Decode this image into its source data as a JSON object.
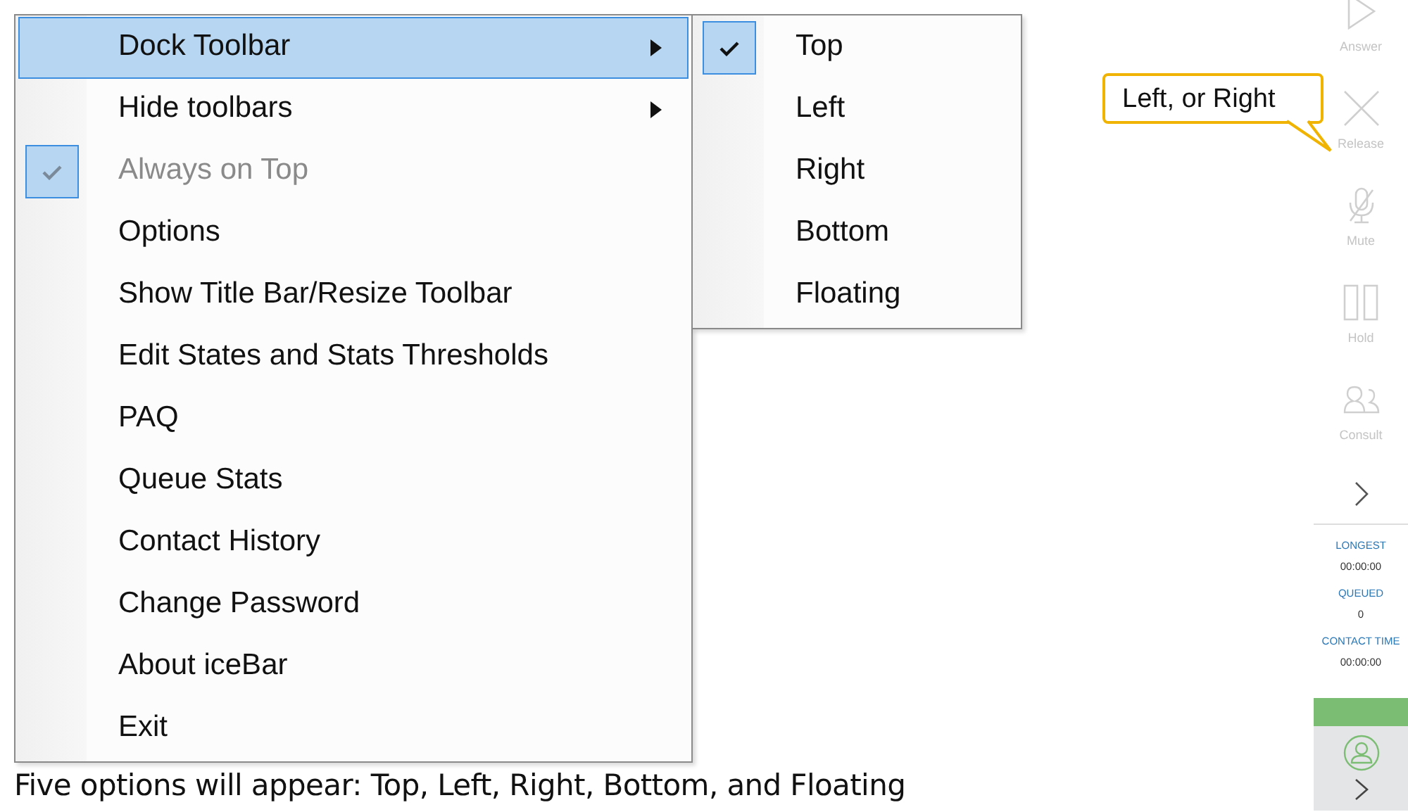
{
  "context_menu": {
    "items": [
      {
        "label": "Dock Toolbar",
        "kind": "submenu",
        "selected": true,
        "checked": false,
        "disabled": false
      },
      {
        "label": "Hide toolbars",
        "kind": "submenu",
        "selected": false,
        "checked": false,
        "disabled": false
      },
      {
        "label": "Always on Top",
        "kind": "command",
        "selected": false,
        "checked": true,
        "disabled": true
      },
      {
        "label": "Options",
        "kind": "command",
        "selected": false,
        "checked": false,
        "disabled": false
      },
      {
        "label": "Show Title Bar/Resize Toolbar",
        "kind": "command",
        "selected": false,
        "checked": false,
        "disabled": false
      },
      {
        "label": "Edit States and Stats Thresholds",
        "kind": "command",
        "selected": false,
        "checked": false,
        "disabled": false
      },
      {
        "label": "PAQ",
        "kind": "command",
        "selected": false,
        "checked": false,
        "disabled": false
      },
      {
        "label": "Queue Stats",
        "kind": "command",
        "selected": false,
        "checked": false,
        "disabled": false
      },
      {
        "label": "Contact History",
        "kind": "command",
        "selected": false,
        "checked": false,
        "disabled": false
      },
      {
        "label": "Change Password",
        "kind": "command",
        "selected": false,
        "checked": false,
        "disabled": false
      },
      {
        "label": "About iceBar",
        "kind": "command",
        "selected": false,
        "checked": false,
        "disabled": false
      },
      {
        "label": "Exit",
        "kind": "command",
        "selected": false,
        "checked": false,
        "disabled": false
      }
    ]
  },
  "submenu": {
    "items": [
      {
        "label": "Top",
        "checked": true
      },
      {
        "label": "Left",
        "checked": false
      },
      {
        "label": "Right",
        "checked": false
      },
      {
        "label": "Bottom",
        "checked": false
      },
      {
        "label": "Floating",
        "checked": false
      }
    ]
  },
  "callout": {
    "text": "Left, or Right"
  },
  "caption": "Five options will appear: Top, Left, Right, Bottom, and Floating",
  "toolbar": {
    "buttons": [
      {
        "kind": "answer",
        "label": "Answer",
        "disabled": true
      },
      {
        "kind": "release",
        "label": "Release",
        "disabled": true
      },
      {
        "kind": "mute",
        "label": "Mute",
        "disabled": true
      },
      {
        "kind": "hold",
        "label": "Hold",
        "disabled": true
      },
      {
        "kind": "consult",
        "label": "Consult",
        "disabled": true
      }
    ],
    "stats": [
      {
        "label": "LONGEST",
        "value": "00:00:00"
      },
      {
        "label": "QUEUED",
        "value": "0"
      },
      {
        "label": "CONTACT TIME",
        "value": "00:00:00"
      }
    ]
  }
}
